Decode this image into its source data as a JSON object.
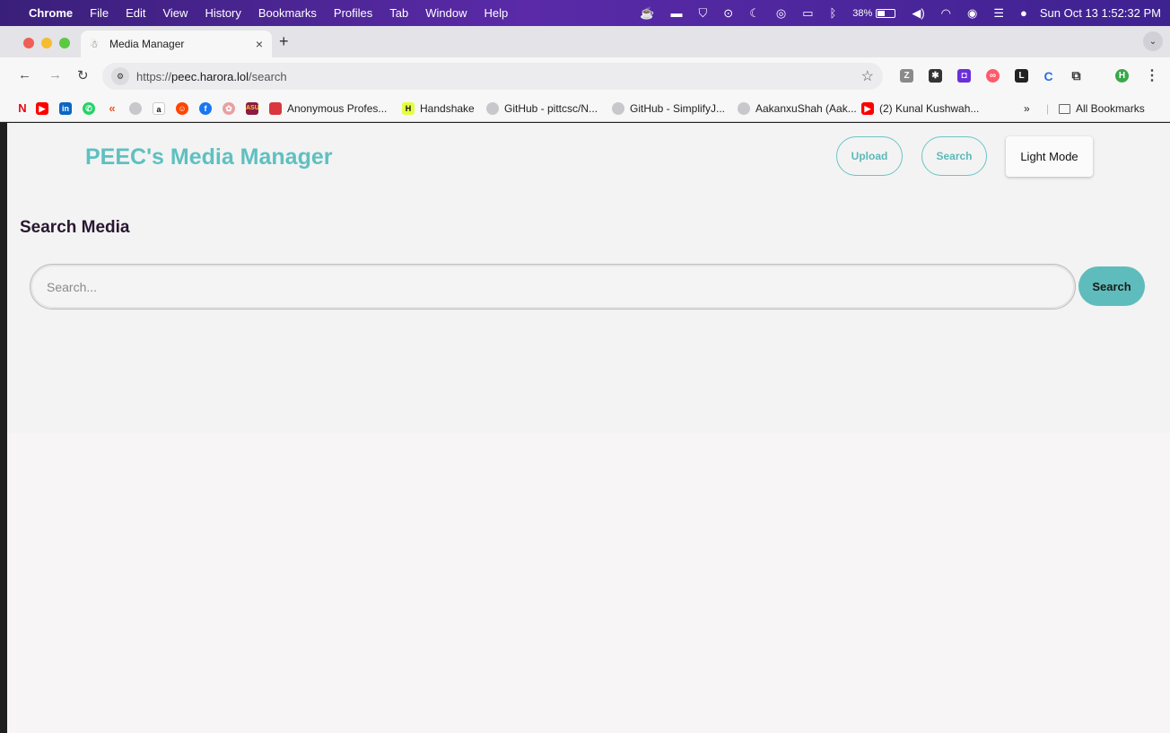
{
  "menubar": {
    "app": "Chrome",
    "items": [
      "File",
      "Edit",
      "View",
      "History",
      "Bookmarks",
      "Profiles",
      "Tab",
      "Window",
      "Help"
    ],
    "battery": "38%",
    "datetime": "Sun Oct 13  1:52:32 PM"
  },
  "browser": {
    "tab_title": "Media Manager",
    "url_scheme": "https://",
    "url_host": "peec.harora.lol",
    "url_path": "/search",
    "profile_initial": "H"
  },
  "bookmarks": {
    "items": [
      "Anonymous Profes...",
      "Handshake",
      "GitHub - pittcsc/N...",
      "GitHub - SimplifyJ...",
      "AakanxuShah (Aak...",
      "(2) Kunal Kushwah..."
    ],
    "overflow": "»",
    "all_bookmarks": "All Bookmarks"
  },
  "app": {
    "brand": "PEEC's Media Manager",
    "nav": {
      "upload": "Upload",
      "search": "Search",
      "mode": "Light Mode"
    },
    "heading": "Search Media",
    "search": {
      "placeholder": "Search...",
      "value": "",
      "button": "Search"
    },
    "accent_color": "#5fbcbc"
  }
}
